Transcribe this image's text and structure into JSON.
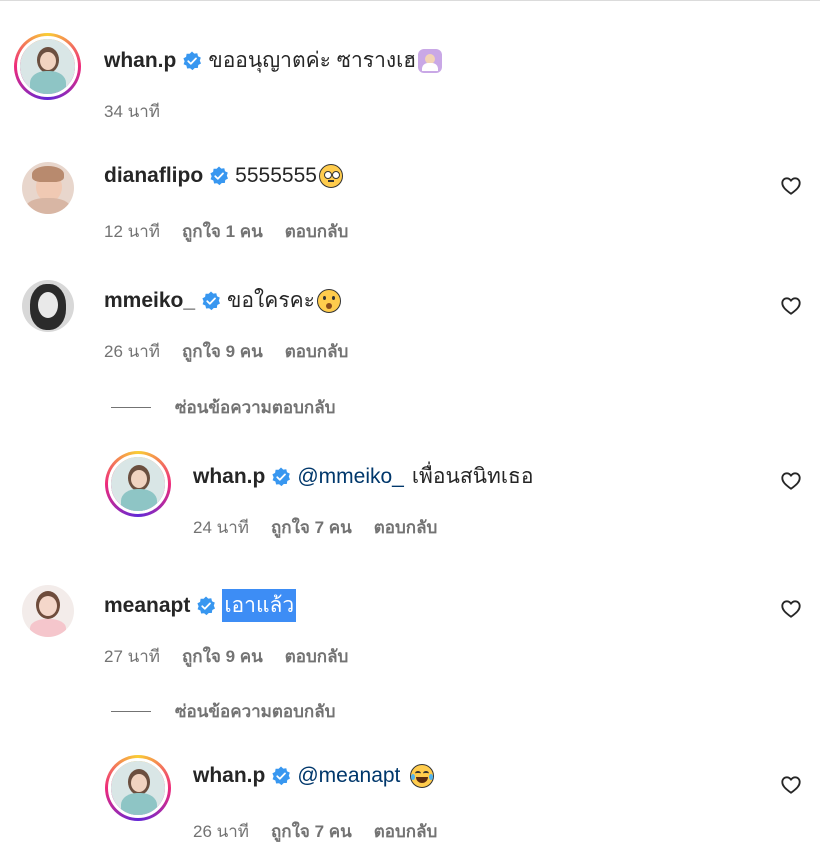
{
  "comments": [
    {
      "username": "whan.p",
      "text": "ขออนุญาตค่ะ ซารางเฮ",
      "emoji": "woman-gesturing-ok",
      "time": "34 นาที"
    },
    {
      "username": "dianaflipo",
      "text": "5555555",
      "emoji": "flushed-face",
      "time": "12 นาที",
      "likes": "ถูกใจ 1 คน",
      "reply": "ตอบกลับ"
    },
    {
      "username": "mmeiko_",
      "text": "ขอใครคะ",
      "emoji": "hushed-face",
      "time": "26 นาที",
      "likes": "ถูกใจ 9 คน",
      "reply": "ตอบกลับ",
      "hide_replies": "ซ่อนข้อความตอบกลับ",
      "reply_item": {
        "username": "whan.p",
        "mention": "@mmeiko_",
        "text": "เพื่อนสนิทเธอ",
        "time": "24 นาที",
        "likes": "ถูกใจ 7 คน",
        "reply": "ตอบกลับ"
      }
    },
    {
      "username": "meanapt",
      "text": "เอาแล้ว",
      "time": "27 นาที",
      "likes": "ถูกใจ 9 คน",
      "reply": "ตอบกลับ",
      "hide_replies": "ซ่อนข้อความตอบกลับ",
      "reply_item": {
        "username": "whan.p",
        "mention": "@meanapt",
        "emoji": "face-with-tears-of-joy",
        "time": "26 นาที",
        "likes": "ถูกใจ 7 คน",
        "reply": "ตอบกลับ"
      }
    }
  ],
  "colors": {
    "verified": "#3897f0",
    "meta": "#737373",
    "mention": "#00376b",
    "selection": "#3d8df5"
  },
  "icons": {
    "verified": "verified-badge-icon",
    "like": "heart-outline-icon"
  }
}
